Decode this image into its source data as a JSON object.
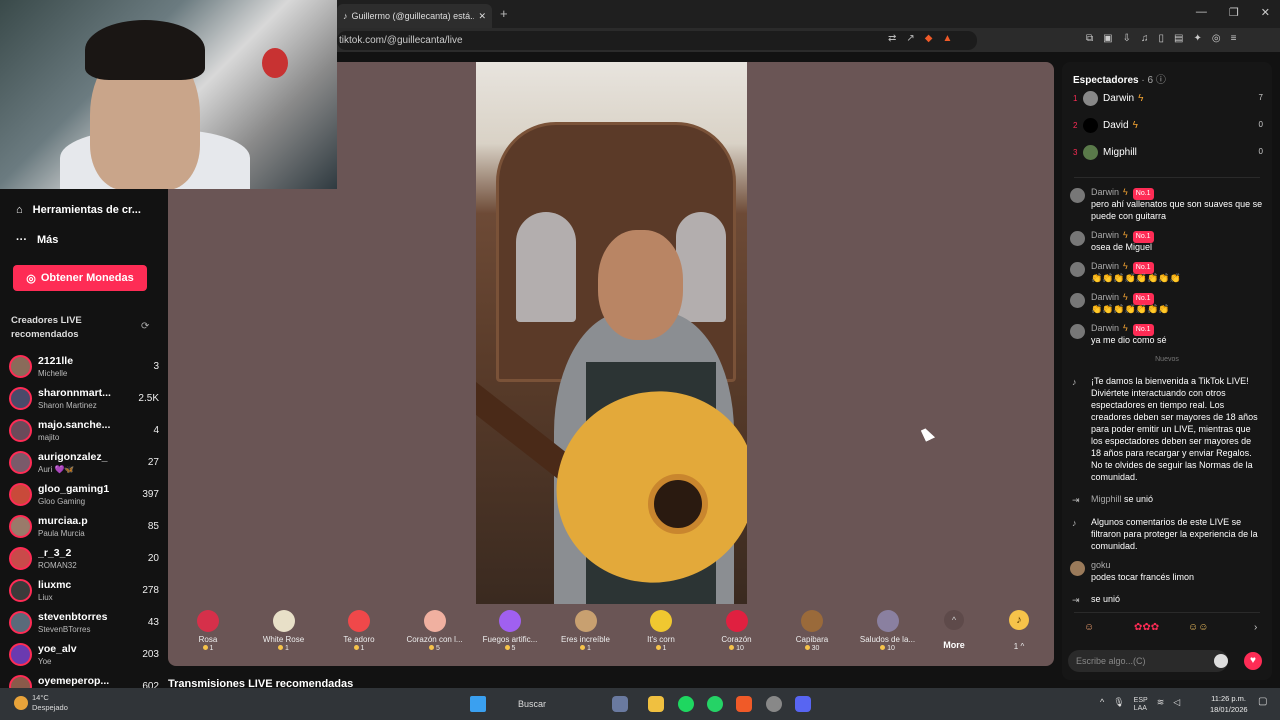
{
  "browser": {
    "tab_title": "Guillermo (@guillecanta) está...",
    "new_tab": "+",
    "url": "tiktok.com/@guillecanta/live",
    "window_controls": [
      "—",
      "❐",
      "✕"
    ]
  },
  "sidebar": {
    "tools": "Herramientas de cr...",
    "more": "Más",
    "get_coins": "Obtener Monedas",
    "recommended_heading": "Creadores LIVE recomendados",
    "creators": [
      {
        "name": "2121lle",
        "sub": "Michelle",
        "count": "3",
        "color": "#8a6b5a"
      },
      {
        "name": "sharonnmart...",
        "sub": "Sharon Martinez",
        "count": "2.5K",
        "color": "#4a4a6a"
      },
      {
        "name": "majo.sanche...",
        "sub": "majito",
        "count": "4",
        "color": "#6a4a5a"
      },
      {
        "name": "aurigonzalez_",
        "sub": "Auri 💜🦋",
        "count": "27",
        "color": "#7a5a6a"
      },
      {
        "name": "gloo_gaming1",
        "sub": "Gloo Gaming",
        "count": "397",
        "color": "#c94a3a"
      },
      {
        "name": "murciaa.p",
        "sub": "Paula Murcia",
        "count": "85",
        "color": "#9a7a6a"
      },
      {
        "name": "_r_3_2",
        "sub": "ROMAN32",
        "count": "20",
        "color": "#c94a4a"
      },
      {
        "name": "liuxmc",
        "sub": "Liux",
        "count": "278",
        "color": "#3a3a3a"
      },
      {
        "name": "stevenbtorres",
        "sub": "StevenBTorres",
        "count": "43",
        "color": "#5a6a7a"
      },
      {
        "name": "yoe_alv",
        "sub": "Yoe",
        "count": "203",
        "color": "#6a3ab0"
      },
      {
        "name": "oyemeperop...",
        "sub": "",
        "count": "602",
        "color": "#8a5a4a"
      }
    ]
  },
  "gifts": [
    {
      "name": "Rosa",
      "price": "1",
      "color": "#d6304a"
    },
    {
      "name": "White Rose",
      "price": "1",
      "color": "#e8e0c8"
    },
    {
      "name": "Te adoro",
      "price": "1",
      "color": "#f0484a"
    },
    {
      "name": "Corazón con l...",
      "price": "5",
      "color": "#f0b0a0"
    },
    {
      "name": "Fuegos artific...",
      "price": "5",
      "color": "#a060f0"
    },
    {
      "name": "Eres increíble",
      "price": "1",
      "color": "#c8a070"
    },
    {
      "name": "It's corn",
      "price": "1",
      "color": "#f0c830"
    },
    {
      "name": "Corazón",
      "price": "10",
      "color": "#e02040"
    },
    {
      "name": "Capibara",
      "price": "30",
      "color": "#9a6a3a"
    },
    {
      "name": "Saludos de la...",
      "price": "10",
      "color": "#8a80a0"
    }
  ],
  "more_label": "More",
  "coin_label": "1 ^",
  "recommended_streams": "Transmisiones LIVE recomendadas",
  "chat": {
    "viewers_heading": "Espectadores",
    "viewers_count": "· 6 ⓘ",
    "top_viewers": [
      {
        "rank": "1",
        "name": "Darwin",
        "score": "7",
        "color": "#888"
      },
      {
        "rank": "2",
        "name": "David",
        "score": "0",
        "color": "#000"
      },
      {
        "rank": "3",
        "name": "Migphill",
        "score": "0",
        "color": "#5a7a4a"
      }
    ],
    "badge": "No.1",
    "messages": [
      {
        "user": "Darwin",
        "text": "pero ahí vallenatos que son suaves que se puede con guitarra"
      },
      {
        "user": "Darwin",
        "text": "osea de Miguel"
      },
      {
        "user": "Darwin",
        "text": "👏👏👏👏👏👏👏👏"
      },
      {
        "user": "Darwin",
        "text": "👏👏👏👏👏👏👏"
      },
      {
        "user": "Darwin",
        "text": "ya me dio como sé"
      }
    ],
    "new_label": "Nuevos",
    "welcome": "¡Te damos la bienvenida a TikTok LIVE! Diviértete interactuando con otros espectadores en tiempo real. Los creadores deben ser mayores de 18 años para poder emitir un LIVE, mientras que los espectadores deben ser mayores de 18 años para recargar y enviar Regalos. No te olvides de seguir las Normas de la comunidad.",
    "join_user": "Migphill",
    "join_text": "se unió",
    "filter_notice": "Algunos comentarios de este LIVE se filtraron para proteger la experiencia de la comunidad.",
    "goku_user": "goku",
    "goku_text": "podes tocar francés limon",
    "join2_text": "se unió",
    "placeholder": "Escribe algo...(C)"
  },
  "taskbar": {
    "temp": "14°C",
    "weather": "Despejado",
    "search": "Buscar",
    "lang1": "ESP",
    "lang2": "LAA",
    "time": "11:26 p.m.",
    "date": "18/01/2026"
  }
}
